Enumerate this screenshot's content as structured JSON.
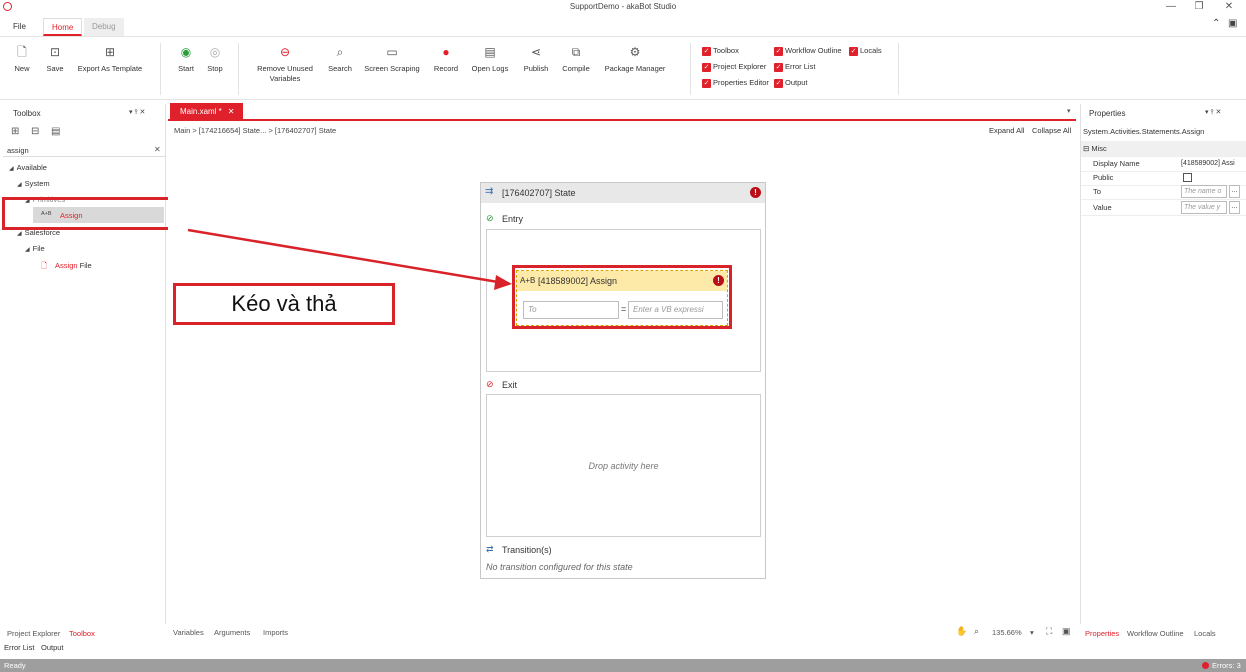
{
  "window": {
    "title": "SupportDemo - akaBot Studio"
  },
  "ribbon_tabs": {
    "file": "File",
    "home": "Home",
    "debug": "Debug"
  },
  "ribbon": {
    "new": "New",
    "save": "Save",
    "export_template": "Export As Template",
    "start": "Start",
    "stop": "Stop",
    "remove_unused_1": "Remove Unused",
    "remove_unused_2": "Variables",
    "search": "Search",
    "screen_scraping": "Screen Scraping",
    "record": "Record",
    "open_logs": "Open Logs",
    "publish": "Publish",
    "compile": "Compile",
    "package_manager": "Package Manager"
  },
  "panels_checks": {
    "toolbox": "Toolbox",
    "project_explorer": "Project Explorer",
    "properties_editor": "Properties Editor",
    "workflow_outline": "Workflow Outline",
    "error_list": "Error List",
    "output": "Output",
    "locals": "Locals"
  },
  "toolbox": {
    "title": "Toolbox",
    "search_value": "assign",
    "tree": {
      "available": "Available",
      "system": "System",
      "primitives": "Primitives",
      "assign": "Assign",
      "salesforce": "Salesforce",
      "file": "File",
      "assign_file_hl": "Assign",
      "assign_file_rest": " File"
    }
  },
  "document": {
    "tab": "Main.xaml *",
    "breadcrumb": "Main  >  [174216654] State...  >  [176402707] State",
    "expand_all": "Expand All",
    "collapse_all": "Collapse All"
  },
  "state": {
    "title": "[176402707] State",
    "entry": "Entry",
    "exit": "Exit",
    "drop_here": "Drop activity here",
    "transitions": "Transition(s)",
    "no_transition": "No transition configured for this state"
  },
  "assign_activity": {
    "icon_text": "A+B",
    "title": "[418589002] Assign",
    "to_placeholder": "To",
    "eq": "=",
    "value_placeholder": "Enter a VB expressi"
  },
  "annotation": {
    "text": "Kéo và thả"
  },
  "properties": {
    "title": "Properties",
    "type": "System.Activities.Statements.Assign",
    "section": "Misc",
    "display_name_label": "Display Name",
    "display_name_value": "[418589002] Assi",
    "public_label": "Public",
    "to_label": "To",
    "to_placeholder": "The name o",
    "value_label": "Value",
    "value_placeholder": "The value y"
  },
  "bottom": {
    "variables": "Variables",
    "arguments": "Arguments",
    "imports": "Imports",
    "zoom": "135.66%",
    "project_explorer": "Project Explorer",
    "toolbox": "Toolbox",
    "error_list": "Error List",
    "output": "Output",
    "properties": "Properties",
    "workflow_outline": "Workflow Outline",
    "locals": "Locals"
  },
  "status": {
    "ready": "Ready",
    "errors": "Errors: 3"
  },
  "colors": {
    "accent": "#e0202a",
    "error": "#b80f17",
    "assign_header": "#fde9a8"
  }
}
